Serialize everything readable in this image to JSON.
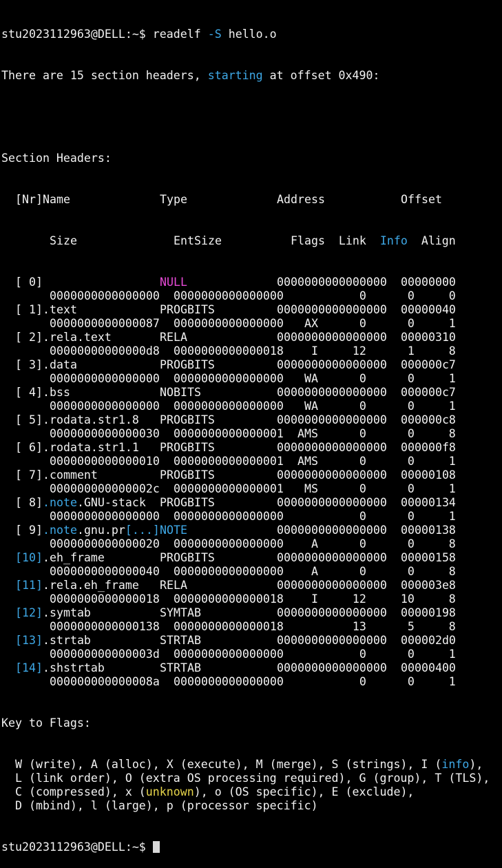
{
  "prompt": "stu2023112963@DELL:~$ ",
  "command": "readelf -S hello.o",
  "cmd_parts": {
    "pre": "readelf ",
    "flag": "-S",
    "post": " hello.o"
  },
  "summary": {
    "pre": "There are 15 section headers, ",
    "word": "starting",
    "post": " at offset 0x490:"
  },
  "section_headers_title": "Section Headers:",
  "header1": {
    "nr": "  [Nr]",
    "name": " Name",
    "type": "Type",
    "address": "Address",
    "offset": "Offset"
  },
  "header2": {
    "size": "Size",
    "entsize": "EntSize",
    "flags_link": "Flags  Link  ",
    "info": "Info",
    "align": "  Align"
  },
  "sections": [
    {
      "nr": "  [ 0]",
      "nr_blue": false,
      "name": " ",
      "name_note": null,
      "type": "NULL",
      "type_color": "pink",
      "address": "0000000000000000",
      "offset": "00000000",
      "size": "0000000000000000",
      "entsize": "0000000000000000",
      "flags": "    ",
      "link": "0",
      "info": "0",
      "align": "0"
    },
    {
      "nr": "  [ 1]",
      "nr_blue": false,
      "name": " .text",
      "name_note": null,
      "type": "PROGBITS",
      "type_color": null,
      "address": "0000000000000000",
      "offset": "00000040",
      "size": "0000000000000087",
      "entsize": "0000000000000000",
      "flags": " AX ",
      "link": "0",
      "info": "0",
      "align": "1"
    },
    {
      "nr": "  [ 2]",
      "nr_blue": false,
      "name": " .rela.text",
      "name_note": null,
      "type": "RELA",
      "type_color": null,
      "address": "0000000000000000",
      "offset": "00000310",
      "size": "00000000000000d8",
      "entsize": "0000000000000018",
      "flags": "  I ",
      "link": "12",
      "info": "1",
      "align": "8"
    },
    {
      "nr": "  [ 3]",
      "nr_blue": false,
      "name": " .data",
      "name_note": null,
      "type": "PROGBITS",
      "type_color": null,
      "address": "0000000000000000",
      "offset": "000000c7",
      "size": "0000000000000000",
      "entsize": "0000000000000000",
      "flags": " WA ",
      "link": "0",
      "info": "0",
      "align": "1"
    },
    {
      "nr": "  [ 4]",
      "nr_blue": false,
      "name": " .bss",
      "name_note": null,
      "type": "NOBITS",
      "type_color": null,
      "address": "0000000000000000",
      "offset": "000000c7",
      "size": "0000000000000000",
      "entsize": "0000000000000000",
      "flags": " WA ",
      "link": "0",
      "info": "0",
      "align": "1"
    },
    {
      "nr": "  [ 5]",
      "nr_blue": false,
      "name": " .rodata.str1.8",
      "name_note": null,
      "type": "PROGBITS",
      "type_color": null,
      "address": "0000000000000000",
      "offset": "000000c8",
      "size": "0000000000000030",
      "entsize": "0000000000000001",
      "flags": "AMS ",
      "link": "0",
      "info": "0",
      "align": "8"
    },
    {
      "nr": "  [ 6]",
      "nr_blue": false,
      "name": " .rodata.str1.1",
      "name_note": null,
      "type": "PROGBITS",
      "type_color": null,
      "address": "0000000000000000",
      "offset": "000000f8",
      "size": "0000000000000010",
      "entsize": "0000000000000001",
      "flags": "AMS ",
      "link": "0",
      "info": "0",
      "align": "1"
    },
    {
      "nr": "  [ 7]",
      "nr_blue": false,
      "name": " .comment",
      "name_note": null,
      "type": "PROGBITS",
      "type_color": null,
      "address": "0000000000000000",
      "offset": "00000108",
      "size": "000000000000002c",
      "entsize": "0000000000000001",
      "flags": " MS ",
      "link": "0",
      "info": "0",
      "align": "1"
    },
    {
      "nr": "  [ 8]",
      "nr_blue": false,
      "name": " ",
      "name_note": {
        "note": ".note",
        "rest": ".GNU-stack",
        "trunc": ""
      },
      "type": "PROGBITS",
      "type_color": null,
      "address": "0000000000000000",
      "offset": "00000134",
      "size": "0000000000000000",
      "entsize": "0000000000000000",
      "flags": "    ",
      "link": "0",
      "info": "0",
      "align": "1"
    },
    {
      "nr": "  [ 9]",
      "nr_blue": false,
      "name": " ",
      "name_note": {
        "note": ".note",
        "rest": ".gnu.pr",
        "trunc": "[...]"
      },
      "type": "NOTE",
      "type_color": "blue",
      "address": "0000000000000000",
      "offset": "00000138",
      "size": "0000000000000020",
      "entsize": "0000000000000000",
      "flags": "  A ",
      "link": "0",
      "info": "0",
      "align": "8"
    },
    {
      "nr": "  [10]",
      "nr_blue": true,
      "name": " .eh_frame",
      "name_note": null,
      "type": "PROGBITS",
      "type_color": null,
      "address": "0000000000000000",
      "offset": "00000158",
      "size": "0000000000000040",
      "entsize": "0000000000000000",
      "flags": "  A ",
      "link": "0",
      "info": "0",
      "align": "8"
    },
    {
      "nr": "  [11]",
      "nr_blue": true,
      "name": " .rela.eh_frame",
      "name_note": null,
      "type": "RELA",
      "type_color": null,
      "address": "0000000000000000",
      "offset": "000003e8",
      "size": "0000000000000018",
      "entsize": "0000000000000018",
      "flags": "  I ",
      "link": "12",
      "info": "10",
      "align": "8"
    },
    {
      "nr": "  [12]",
      "nr_blue": true,
      "name": " .symtab",
      "name_note": null,
      "type": "SYMTAB",
      "type_color": null,
      "address": "0000000000000000",
      "offset": "00000198",
      "size": "0000000000000138",
      "entsize": "0000000000000018",
      "flags": "    ",
      "link": "13",
      "info": "5",
      "align": "8"
    },
    {
      "nr": "  [13]",
      "nr_blue": true,
      "name": " .strtab",
      "name_note": null,
      "type": "STRTAB",
      "type_color": null,
      "address": "0000000000000000",
      "offset": "000002d0",
      "size": "000000000000003d",
      "entsize": "0000000000000000",
      "flags": "    ",
      "link": "0",
      "info": "0",
      "align": "1"
    },
    {
      "nr": "  [14]",
      "nr_blue": true,
      "name": " .shstrtab",
      "name_note": null,
      "type": "STRTAB",
      "type_color": null,
      "address": "0000000000000000",
      "offset": "00000400",
      "size": "000000000000008a",
      "entsize": "0000000000000000",
      "flags": "    ",
      "link": "0",
      "info": "0",
      "align": "1"
    }
  ],
  "key_title": "Key to Flags:",
  "key_lines": [
    {
      "pre": "  W (write), A (alloc), X (execute), M (merge), S (strings), I (",
      "hl": "info",
      "hl_color": "blue",
      "post": "),"
    },
    {
      "pre": "  L (link order), O (extra OS processing required), G (group), T (TLS),",
      "hl": "",
      "hl_color": null,
      "post": ""
    },
    {
      "pre": "  C (compressed), x (",
      "hl": "unknown",
      "hl_color": "yellow",
      "post": "), o (OS specific), E (exclude),"
    },
    {
      "pre": "  D (mbind), l (large), p (processor specific)",
      "hl": "",
      "hl_color": null,
      "post": ""
    }
  ],
  "colors": {
    "background": "#000000",
    "text": "#f2f2f2",
    "blue": "#3ea8e6",
    "pink": "#e64ad6",
    "yellow": "#e6d44a"
  }
}
